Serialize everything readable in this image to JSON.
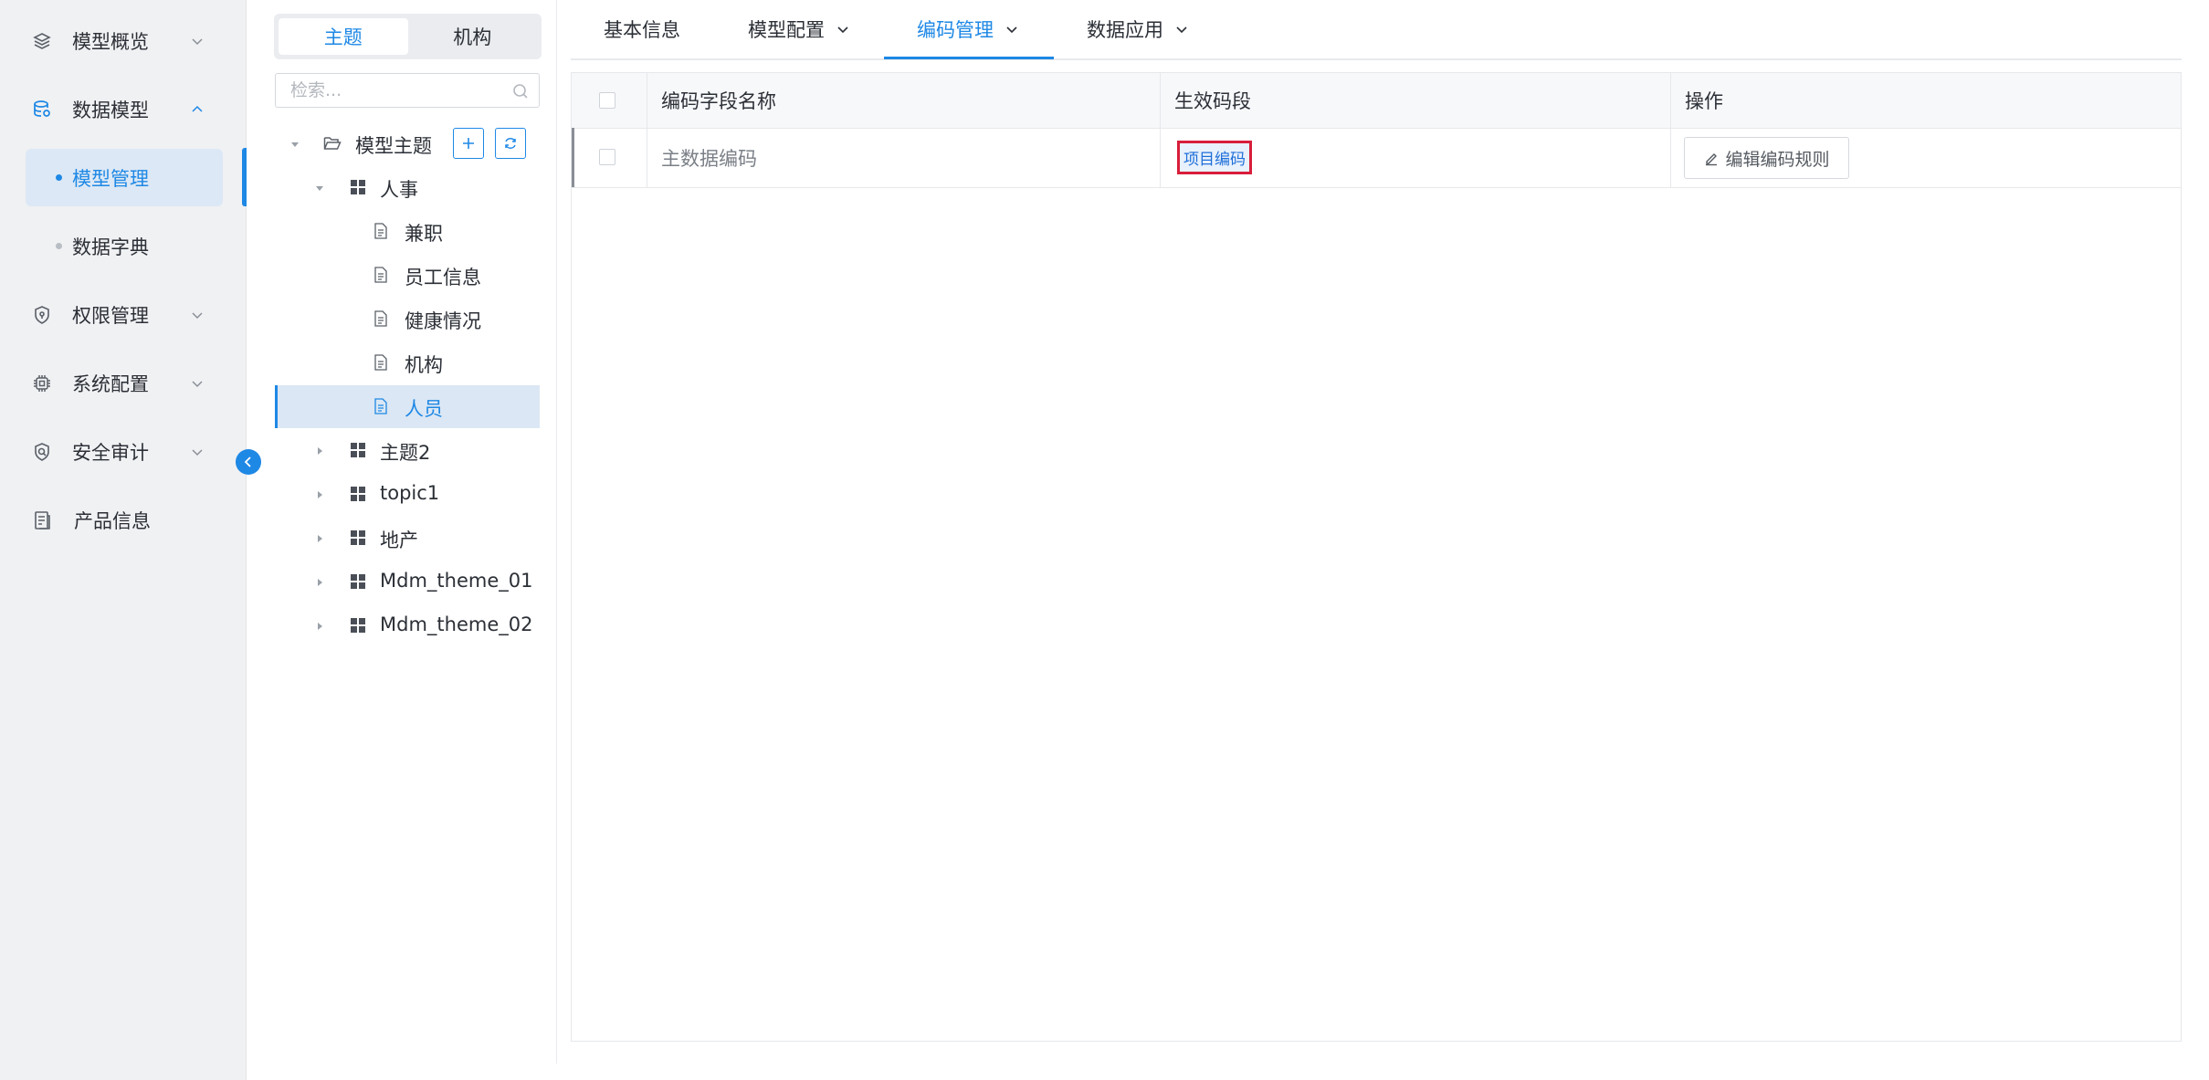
{
  "sidebar": {
    "items": [
      {
        "label": "模型概览",
        "icon": "layers-icon",
        "expanded": false
      },
      {
        "label": "数据模型",
        "icon": "database-icon",
        "expanded": true
      },
      {
        "label": "权限管理",
        "icon": "shield-icon",
        "expanded": false
      },
      {
        "label": "系统配置",
        "icon": "chip-icon",
        "expanded": false
      },
      {
        "label": "安全审计",
        "icon": "audit-icon",
        "expanded": false
      },
      {
        "label": "产品信息",
        "icon": "document-icon"
      }
    ],
    "sub_items": [
      {
        "label": "模型管理",
        "active": true
      },
      {
        "label": "数据字典",
        "active": false
      }
    ],
    "accent": "#1e88e5"
  },
  "tree_panel": {
    "segments": [
      {
        "label": "主题",
        "active": true
      },
      {
        "label": "机构",
        "active": false
      }
    ],
    "search_placeholder": "检索...",
    "root": {
      "label": "模型主题"
    },
    "nodes": [
      {
        "label": "人事",
        "type": "group",
        "expanded": true
      },
      {
        "label": "兼职",
        "type": "leaf"
      },
      {
        "label": "员工信息",
        "type": "leaf"
      },
      {
        "label": "健康情况",
        "type": "leaf"
      },
      {
        "label": "机构",
        "type": "leaf"
      },
      {
        "label": "人员",
        "type": "leaf",
        "selected": true
      },
      {
        "label": "主题2",
        "type": "group",
        "expanded": false
      },
      {
        "label": "topic1",
        "type": "group",
        "expanded": false
      },
      {
        "label": "地产",
        "type": "group",
        "expanded": false
      },
      {
        "label": "Mdm_theme_01",
        "type": "group",
        "expanded": false
      },
      {
        "label": "Mdm_theme_02",
        "type": "group",
        "expanded": false
      }
    ]
  },
  "tabs": [
    {
      "label": "基本信息",
      "has_dropdown": false,
      "active": false
    },
    {
      "label": "模型配置",
      "has_dropdown": true,
      "active": false
    },
    {
      "label": "编码管理",
      "has_dropdown": true,
      "active": true
    },
    {
      "label": "数据应用",
      "has_dropdown": true,
      "active": false
    }
  ],
  "table": {
    "columns": [
      "编码字段名称",
      "生效码段",
      "操作"
    ],
    "rows": [
      {
        "name": "主数据编码",
        "segment_tag": "项目编码",
        "action": "编辑编码规则"
      }
    ]
  }
}
